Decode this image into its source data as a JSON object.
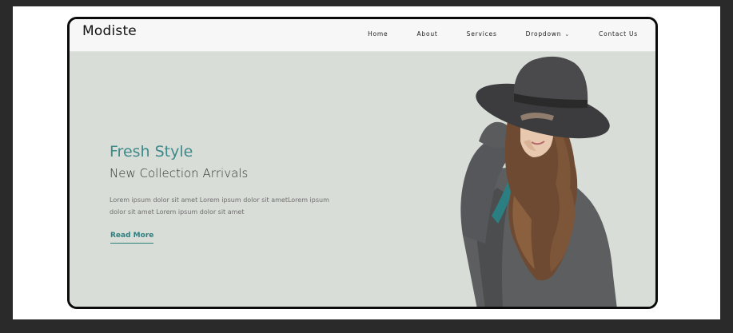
{
  "brand": {
    "name": "Modiste"
  },
  "nav": {
    "items": [
      {
        "label": "Home"
      },
      {
        "label": "About"
      },
      {
        "label": "Services"
      },
      {
        "label": "Dropdown"
      },
      {
        "label": "Contact Us"
      }
    ]
  },
  "hero": {
    "eyebrow": "Fresh Style",
    "headline": "New Collection Arrivals",
    "body": "Lorem ipsum dolor sit amet Lorem ipsum dolor sit ametLorem ipsum dolor sit amet Lorem ipsum dolor sit amet",
    "cta": "Read More"
  },
  "colors": {
    "accent": "#3d8a8a",
    "hero_background": "#d9ddd8",
    "navbar_background": "#f7f7f7",
    "frame_border": "#0b0b0b"
  },
  "icons": {
    "dropdown": "chevron-down-icon"
  }
}
